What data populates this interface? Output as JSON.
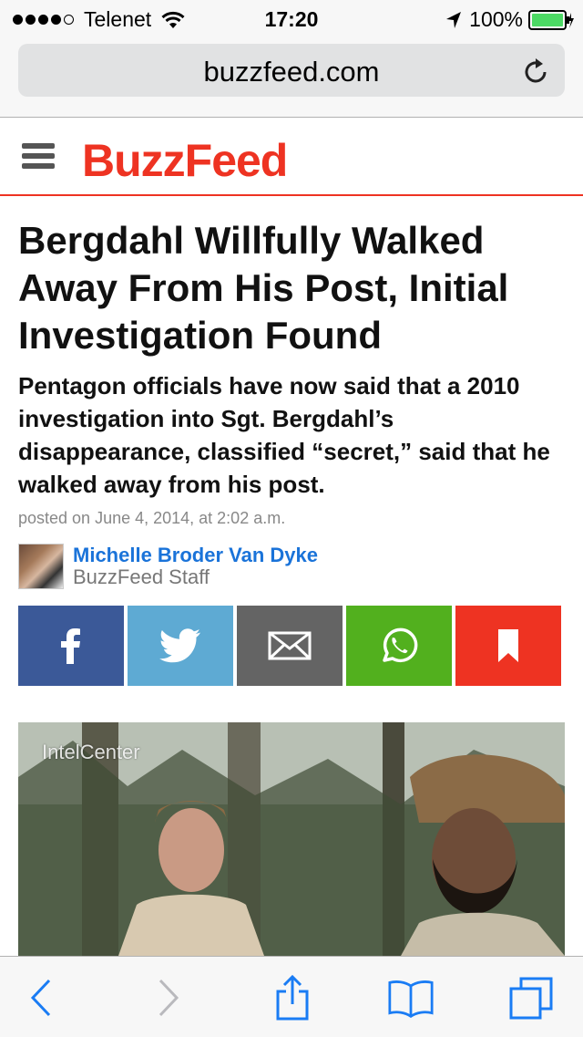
{
  "status_bar": {
    "carrier": "Telenet",
    "time": "17:20",
    "battery": "100%"
  },
  "browser": {
    "url": "buzzfeed.com"
  },
  "site": {
    "logo": "BuzzFeed",
    "brand_color": "#ee3322"
  },
  "article": {
    "headline": "Bergdahl Willfully Walked Away From His Post, Initial Investigation Found",
    "dek": "Pentagon officials have now said that a 2010 investigation into Sgt. Bergdahl’s disappearance, classified “secret,” said that he walked away from his post.",
    "posted": "posted on June 4, 2014, at 2:02 a.m.",
    "author_name": "Michelle Broder Van Dyke",
    "author_role": "BuzzFeed Staff",
    "photo_watermark": "IntelCenter"
  },
  "share_buttons": [
    {
      "icon": "facebook-icon",
      "color": "#3b5998"
    },
    {
      "icon": "twitter-icon",
      "color": "#5eaad3"
    },
    {
      "icon": "email-icon",
      "color": "#646464"
    },
    {
      "icon": "whatsapp-icon",
      "color": "#52b01e"
    },
    {
      "icon": "bookmark-icon",
      "color": "#ee3322"
    }
  ],
  "toolbar": {
    "icons": [
      "back-icon",
      "forward-icon",
      "share-icon",
      "bookmarks-icon",
      "tabs-icon"
    ],
    "accent": "#1a7cf4"
  }
}
